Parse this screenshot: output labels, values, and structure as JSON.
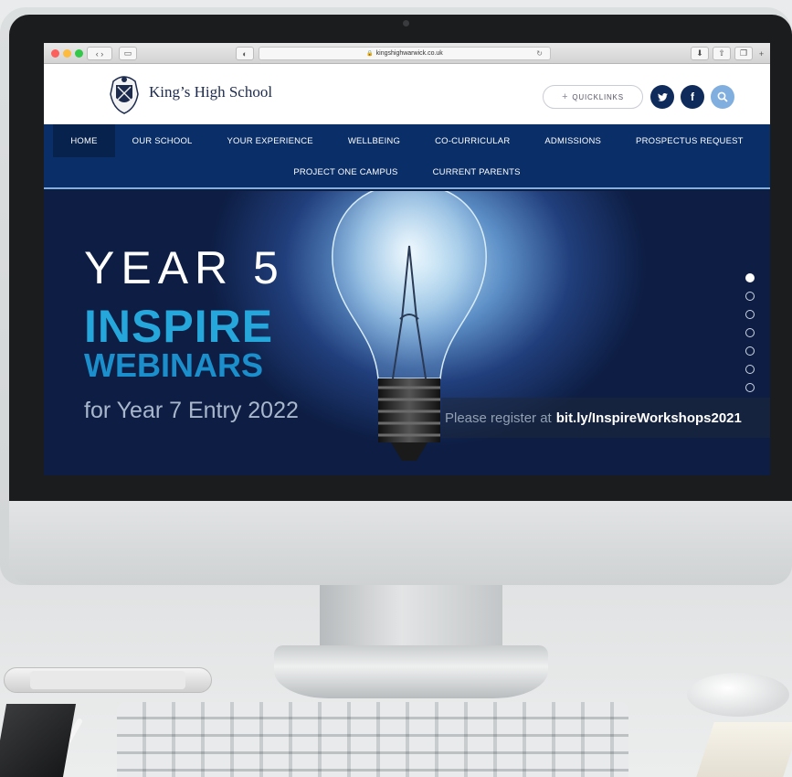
{
  "browser": {
    "url": "kingshighwarwick.co.uk"
  },
  "header": {
    "school_name": "King’s High School",
    "quicklinks_label": "QUICKLINKS"
  },
  "nav": {
    "row1": [
      "HOME",
      "OUR SCHOOL",
      "YOUR EXPERIENCE",
      "WELLBEING",
      "CO-CURRICULAR",
      "ADMISSIONS",
      "PROSPECTUS REQUEST"
    ],
    "row2": [
      "PROJECT ONE CAMPUS",
      "CURRENT PARENTS"
    ],
    "active": "HOME"
  },
  "hero": {
    "year": "YEAR 5",
    "inspire": "INSPIRE",
    "webinars": "WEBINARS",
    "entry": "for Year 7 Entry 2022",
    "register_prefix": "Please register at",
    "register_link": "bit.ly/InspireWorkshops2021",
    "slides_total": 7,
    "slide_active": 1
  },
  "colors": {
    "nav_bg": "#0a2f68",
    "accent_light_blue": "#7faedf",
    "inspire_blue": "#25a7dc",
    "brand_navy": "#0f2b5b"
  },
  "icons": [
    "twitter-icon",
    "facebook-icon",
    "search-icon",
    "lock-icon",
    "reload-icon",
    "share-icon",
    "tabs-icon",
    "download-icon",
    "sidebar-icon",
    "reader-icon"
  ]
}
